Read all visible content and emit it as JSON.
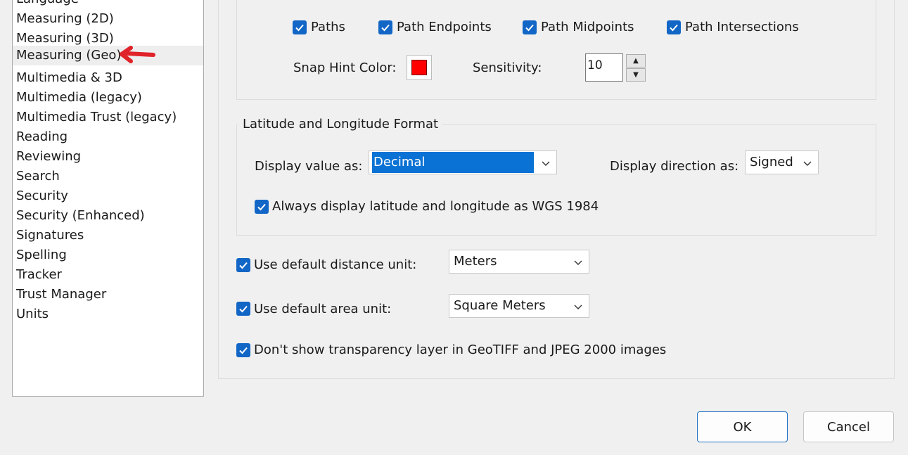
{
  "categories": [
    {
      "label": "Language"
    },
    {
      "label": "Measuring (2D)"
    },
    {
      "label": "Measuring (3D)"
    },
    {
      "label": "Measuring (Geo)",
      "selected": true
    },
    {
      "label": "Multimedia & 3D"
    },
    {
      "label": "Multimedia (legacy)"
    },
    {
      "label": "Multimedia Trust (legacy)"
    },
    {
      "label": "Reading"
    },
    {
      "label": "Reviewing"
    },
    {
      "label": "Search"
    },
    {
      "label": "Security"
    },
    {
      "label": "Security (Enhanced)"
    },
    {
      "label": "Signatures"
    },
    {
      "label": "Spelling"
    },
    {
      "label": "Tracker"
    },
    {
      "label": "Trust Manager"
    },
    {
      "label": "Units"
    }
  ],
  "snapping": {
    "paths": {
      "label": "Paths",
      "checked": true
    },
    "path_endpoints": {
      "label": "Path Endpoints",
      "checked": true
    },
    "path_midpoints": {
      "label": "Path Midpoints",
      "checked": true
    },
    "path_intersections": {
      "label": "Path Intersections",
      "checked": true
    },
    "snap_hint_color_label": "Snap Hint Color:",
    "snap_hint_color": "#ff0000",
    "sensitivity_label": "Sensitivity:",
    "sensitivity_value": "10"
  },
  "latlong": {
    "title": "Latitude and Longitude Format",
    "display_value_label": "Display value as:",
    "display_value": "Decimal",
    "display_direction_label": "Display direction as:",
    "display_direction": "Signed",
    "wgs_label": "Always display latitude and longitude as WGS 1984",
    "wgs_checked": true
  },
  "units": {
    "distance_label": "Use default distance unit:",
    "distance_value": "Meters",
    "distance_checked": true,
    "area_label": "Use default area unit:",
    "area_value": "Square Meters",
    "area_checked": true,
    "transparency_label": "Don't show transparency layer in GeoTIFF and JPEG 2000 images",
    "transparency_checked": true
  },
  "buttons": {
    "ok": "OK",
    "cancel": "Cancel"
  },
  "colors": {
    "accent": "#1166c6",
    "selection": "#0a72d4",
    "annotation_arrow": "#e0232a"
  }
}
